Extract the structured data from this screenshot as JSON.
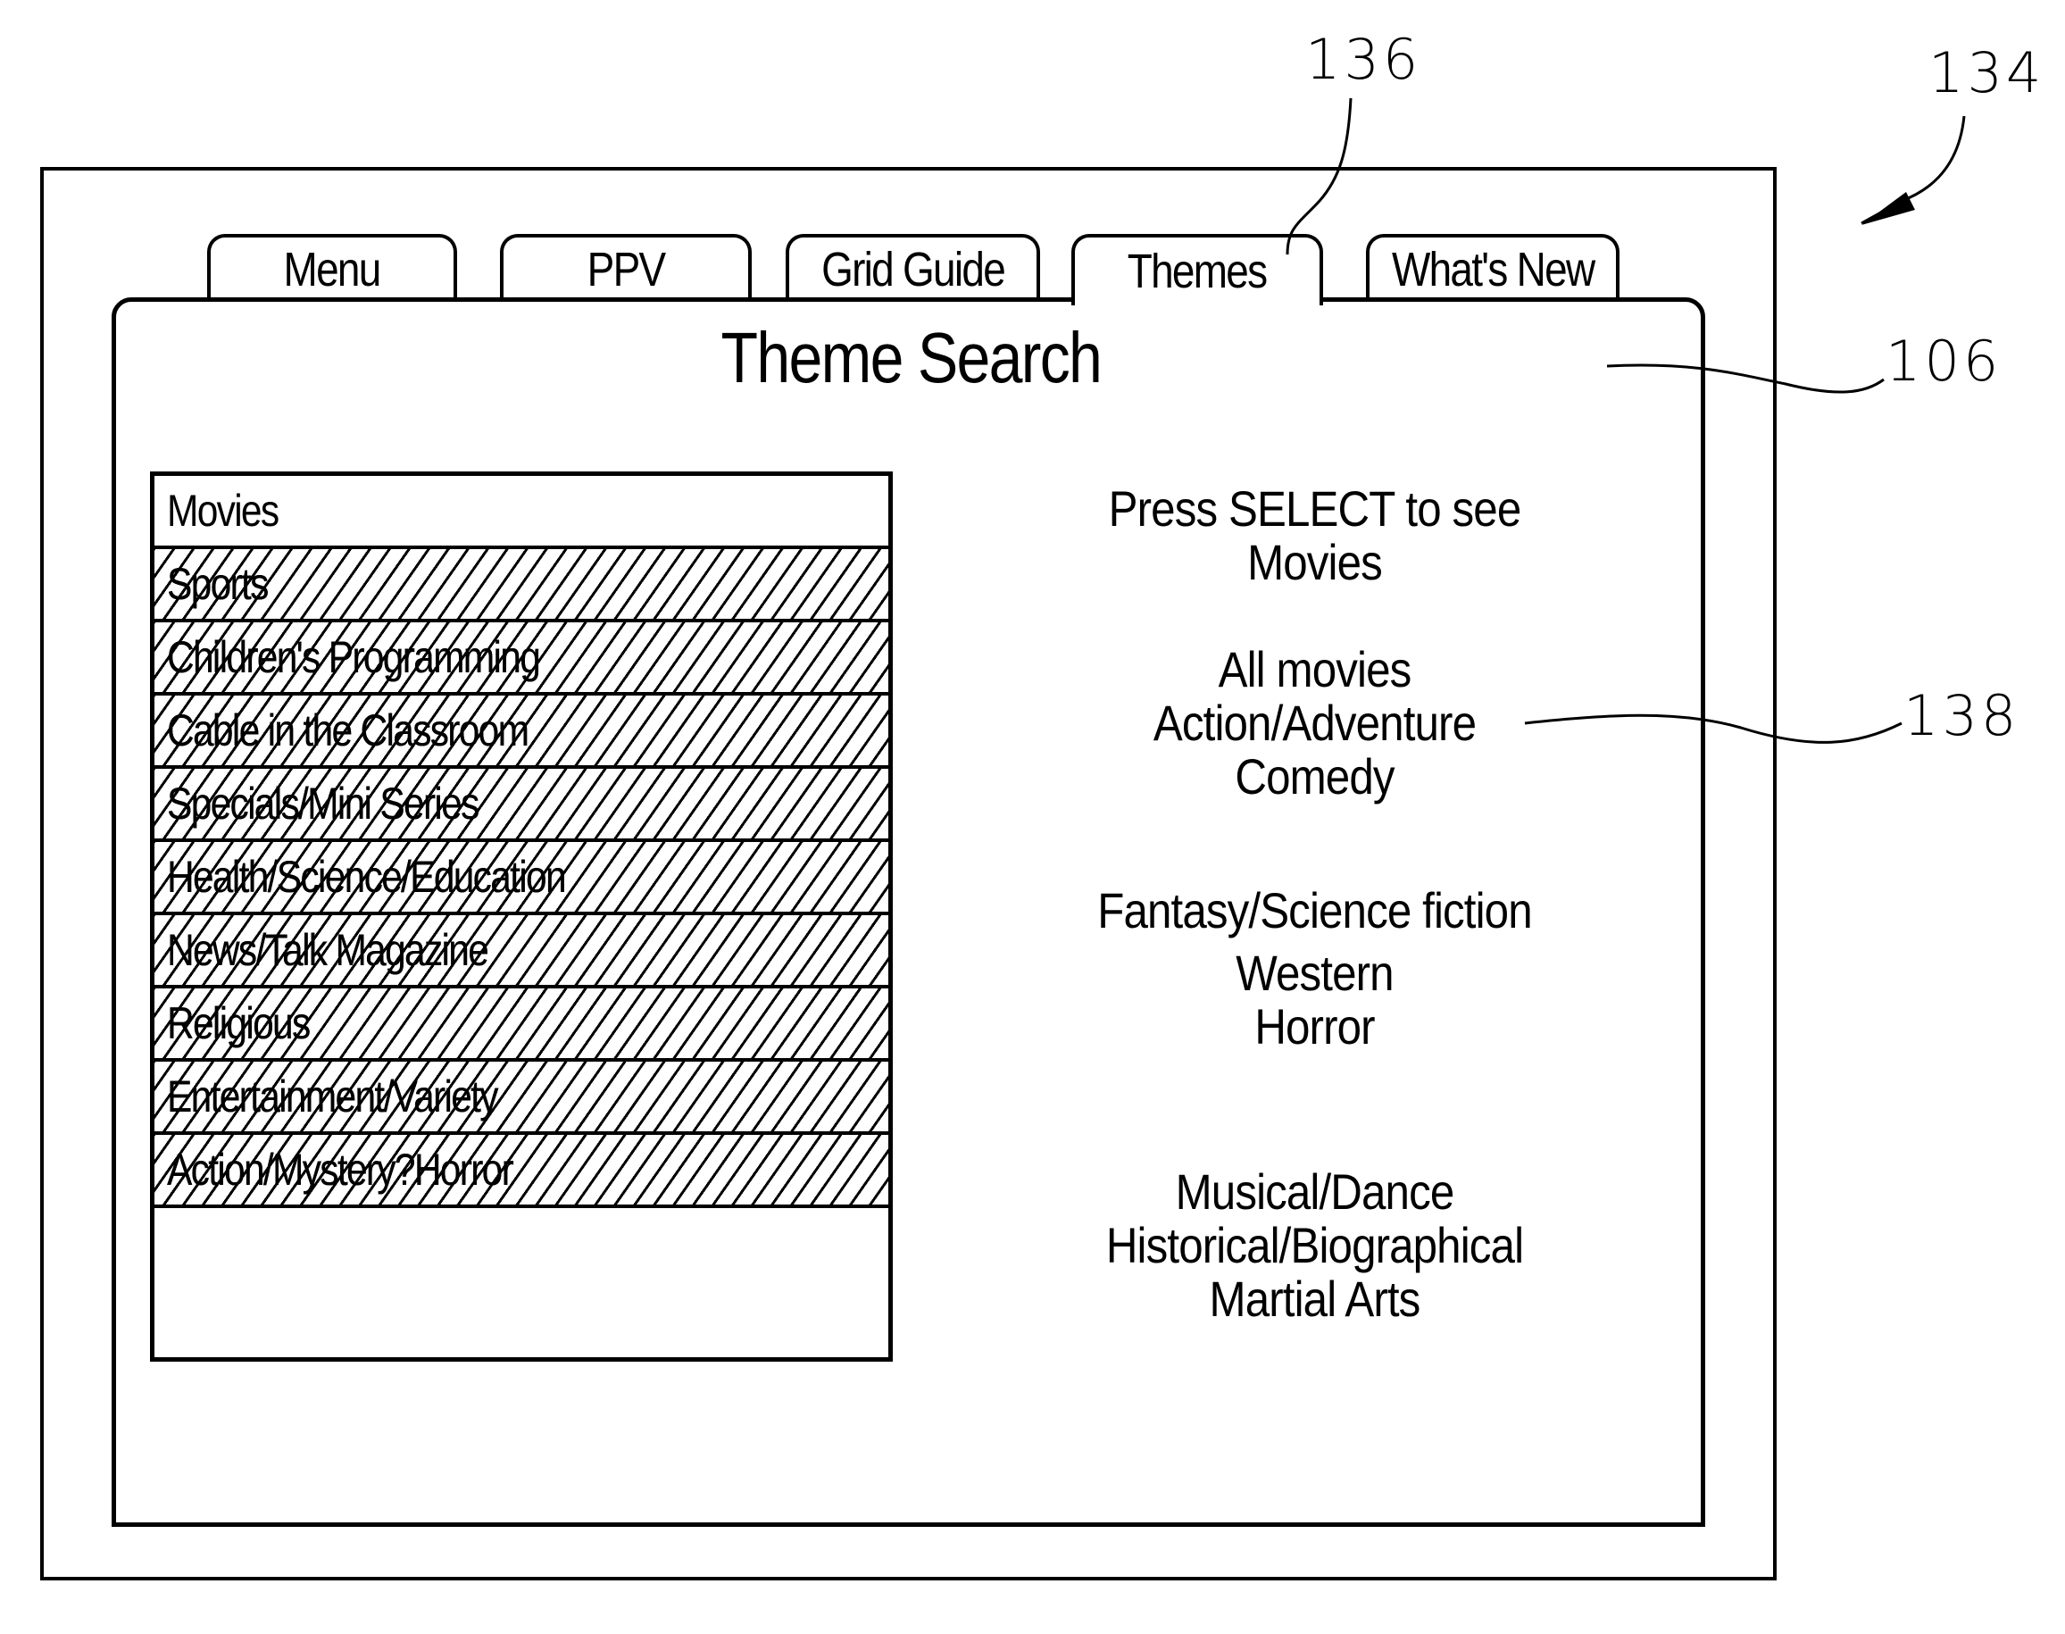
{
  "tabs": [
    {
      "label": "Menu",
      "active": false
    },
    {
      "label": "PPV",
      "active": false
    },
    {
      "label": "Grid Guide",
      "active": false
    },
    {
      "label": "Themes",
      "active": true
    },
    {
      "label": "What's New",
      "active": false
    }
  ],
  "page_title": "Theme Search",
  "theme_list": {
    "selected_index": 0,
    "items": [
      {
        "label": "Movies",
        "hatched": false
      },
      {
        "label": "Sports",
        "hatched": true
      },
      {
        "label": "Children's Programming",
        "hatched": true
      },
      {
        "label": "Cable in the Classroom",
        "hatched": true
      },
      {
        "label": "Specials/Mini Series",
        "hatched": true
      },
      {
        "label": "Health/Science/Education",
        "hatched": true
      },
      {
        "label": "News/Talk Magazine",
        "hatched": true
      },
      {
        "label": "Religious",
        "hatched": true
      },
      {
        "label": "Entertainment/Variety",
        "hatched": true
      },
      {
        "label": "Action/Mystery?Horror",
        "hatched": true
      }
    ]
  },
  "description": {
    "prompt_lines": [
      "Press SELECT to see",
      "Movies"
    ],
    "subcategory_groups": [
      [
        "All movies",
        "Action/Adventure",
        "Comedy"
      ],
      [
        "Fantasy/Science fiction",
        "Western",
        "Horror"
      ],
      [
        "Musical/Dance",
        "Historical/Biographical",
        "Martial Arts"
      ]
    ]
  },
  "callouts": {
    "figure": "134",
    "tab_bar": "136",
    "display_panel": "106",
    "subcategory_text": "138"
  }
}
